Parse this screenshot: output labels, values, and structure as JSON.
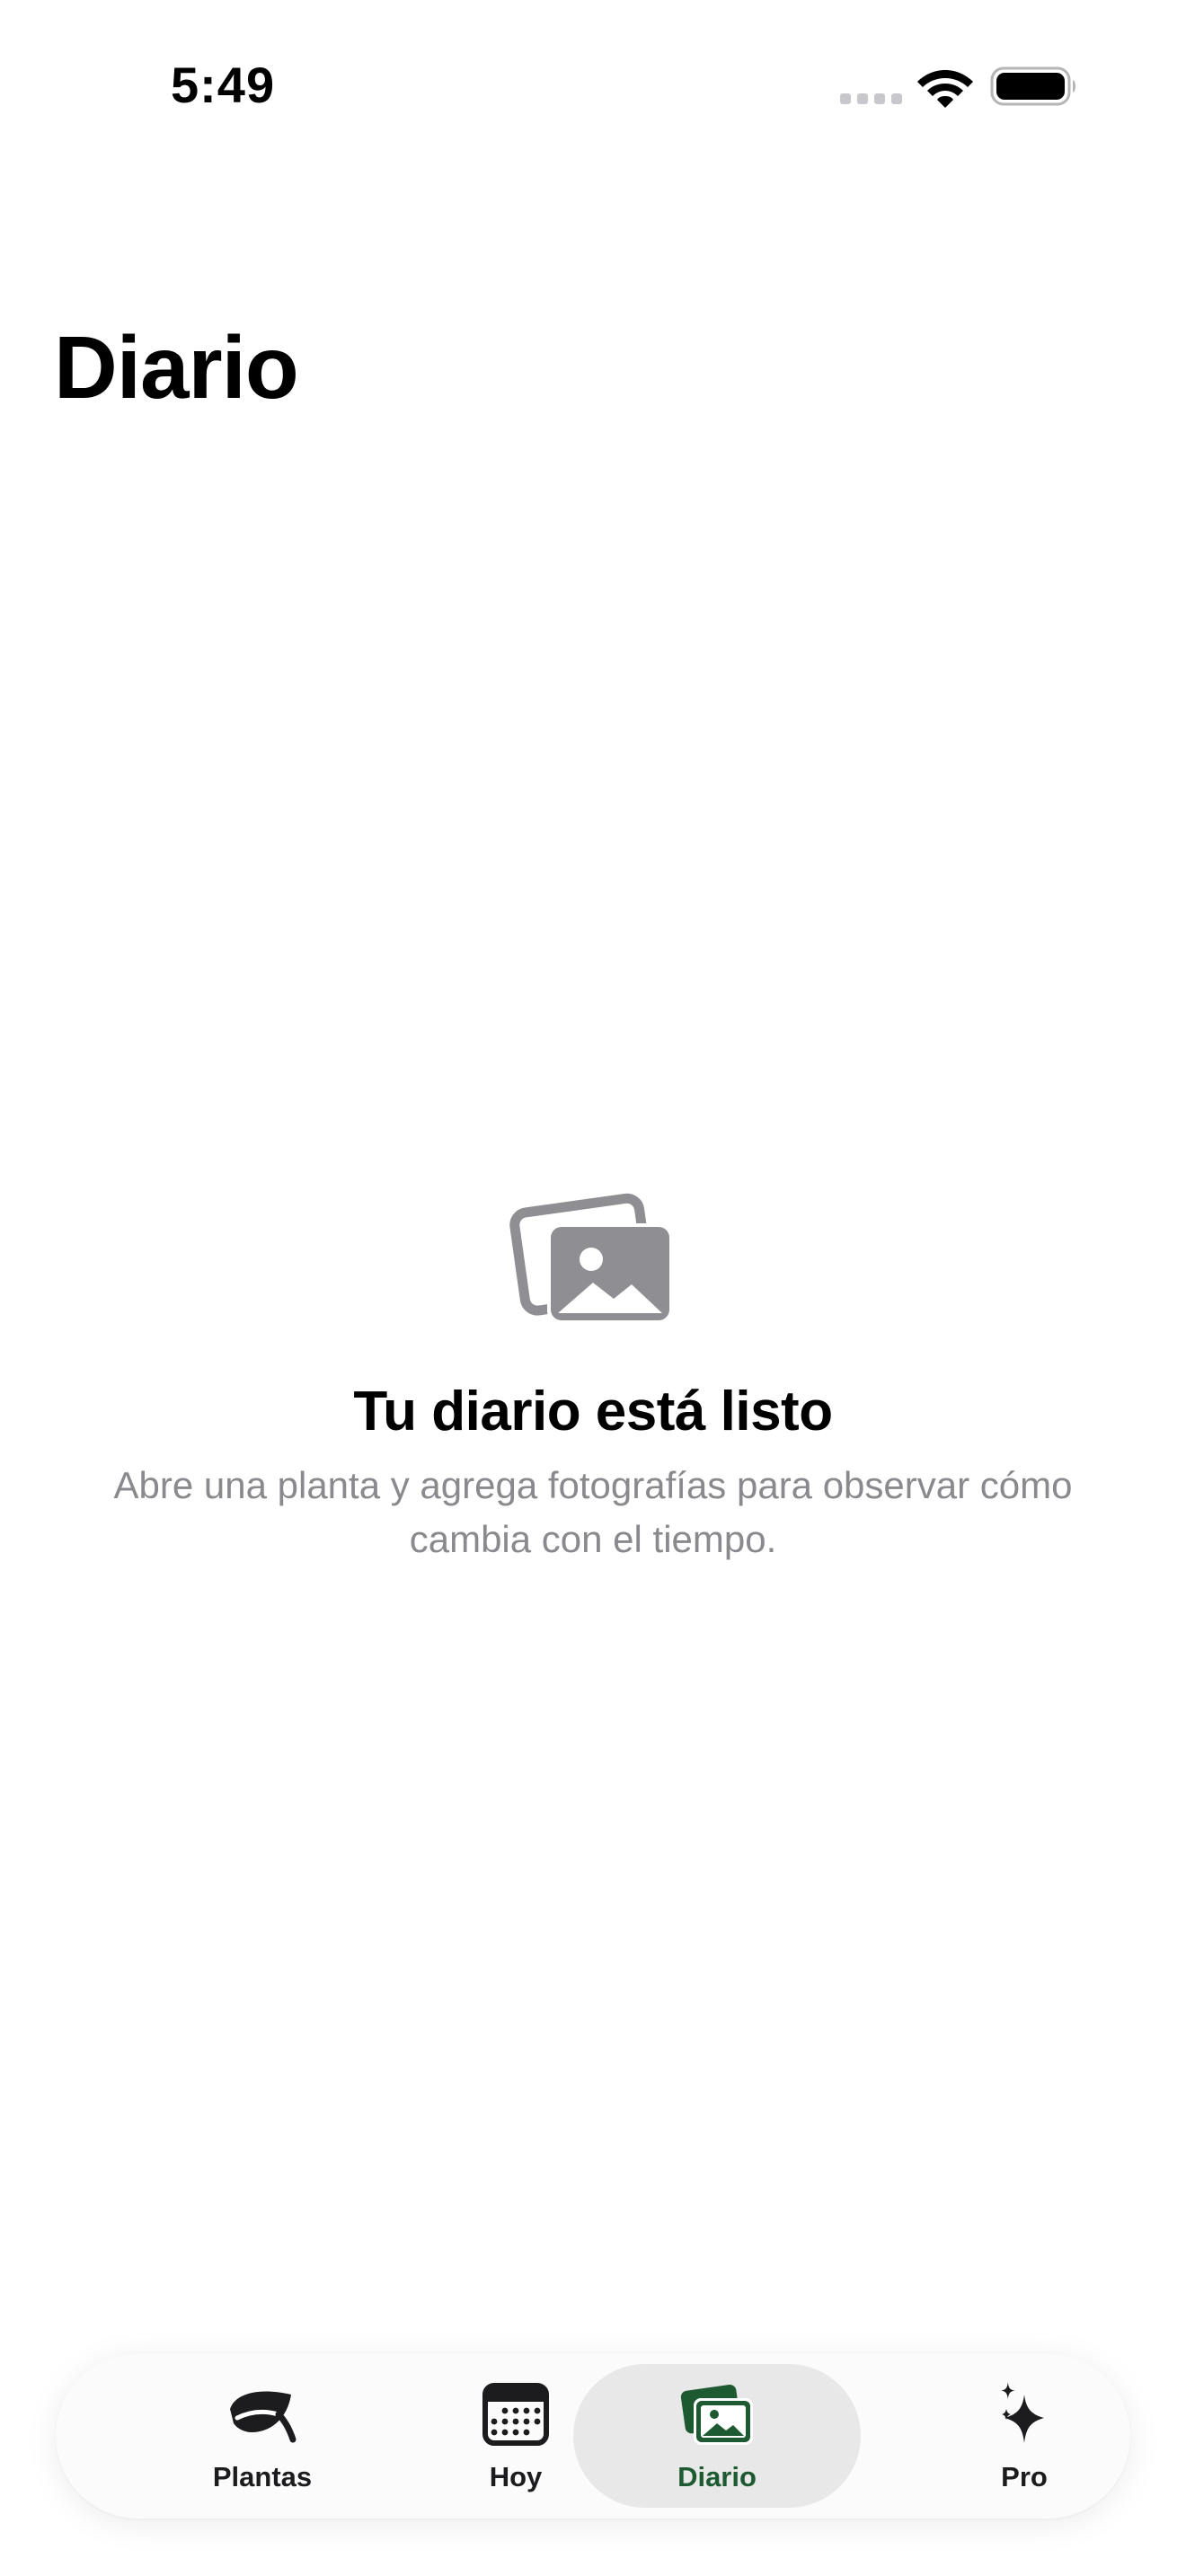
{
  "status_bar": {
    "time": "5:49"
  },
  "header": {
    "title": "Diario"
  },
  "empty_state": {
    "icon": "photo-stack-icon",
    "title": "Tu diario está listo",
    "description": "Abre una planta y agrega fotografías para observar cómo cambia con el tiempo."
  },
  "tab_bar": {
    "active_color": "#1d5a32",
    "tabs": [
      {
        "label": "Plantas",
        "icon": "leaf-icon",
        "active": false
      },
      {
        "label": "Hoy",
        "icon": "calendar-icon",
        "active": false
      },
      {
        "label": "Diario",
        "icon": "photos-icon",
        "active": true
      },
      {
        "label": "Pro",
        "icon": "sparkles-icon",
        "active": false
      }
    ]
  }
}
